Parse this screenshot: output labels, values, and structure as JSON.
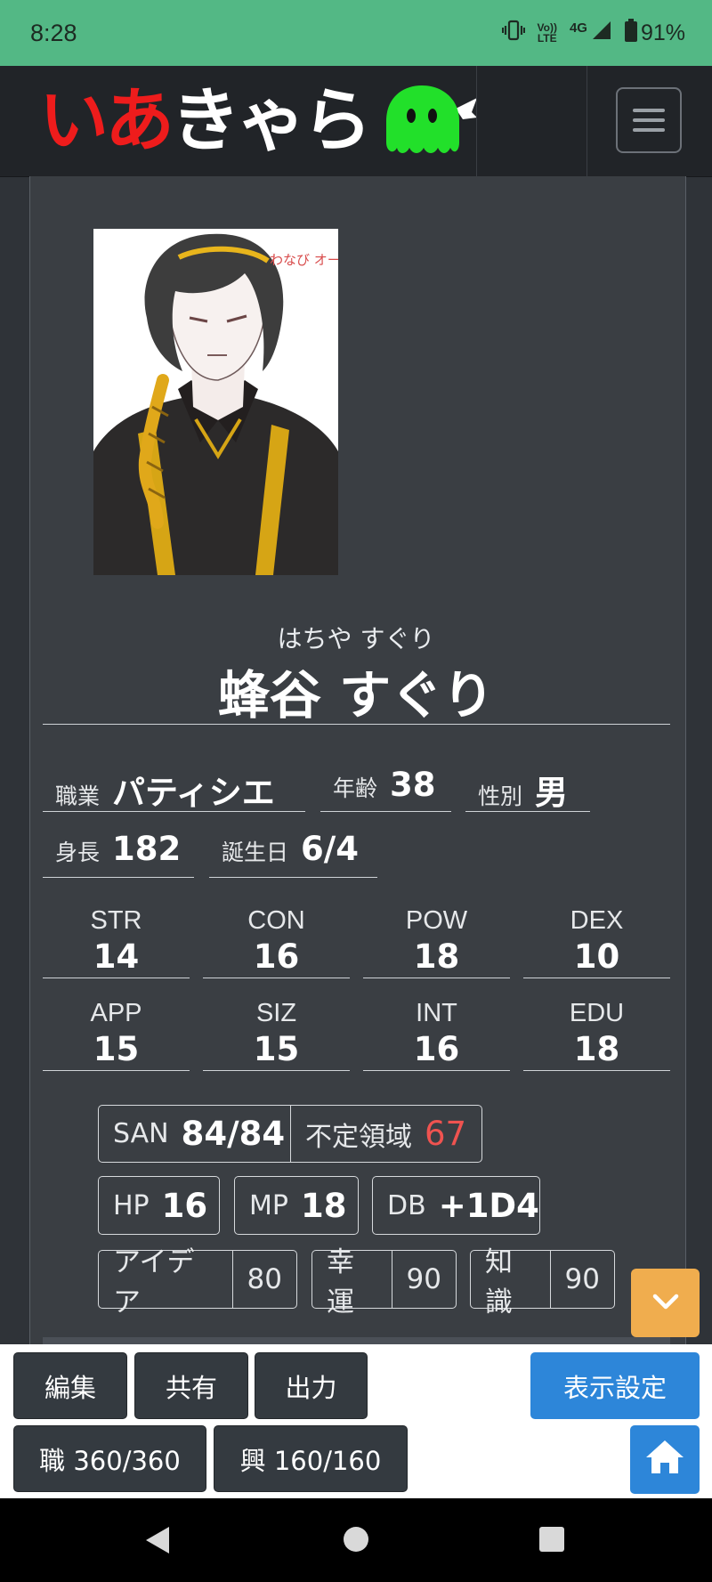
{
  "status_bar": {
    "time": "8:28",
    "network_label_top": "Vo))",
    "network_label_bottom": "LTE",
    "network_type": "4G",
    "battery": "91%"
  },
  "header": {
    "logo_red": "いあ",
    "logo_white": "きゃら",
    "menu_icon": "hamburger-icon"
  },
  "character": {
    "portrait_signature": "わなび オーナー(館)",
    "ruby": "はちや すぐり",
    "name": "蜂谷 すぐり",
    "profile": {
      "occupation_label": "職業",
      "occupation": "パティシエ",
      "age_label": "年齢",
      "age": "38",
      "gender_label": "性別",
      "gender": "男",
      "height_label": "身長",
      "height": "182",
      "birthday_label": "誕生日",
      "birthday": "6/4"
    },
    "stats": [
      {
        "label": "STR",
        "value": "14"
      },
      {
        "label": "CON",
        "value": "16"
      },
      {
        "label": "POW",
        "value": "18"
      },
      {
        "label": "DEX",
        "value": "10"
      },
      {
        "label": "APP",
        "value": "15"
      },
      {
        "label": "SIZ",
        "value": "15"
      },
      {
        "label": "INT",
        "value": "16"
      },
      {
        "label": "EDU",
        "value": "18"
      }
    ],
    "derived": {
      "san_label": "SAN",
      "san": "84/84",
      "indef_label": "不定領域",
      "indef": "67",
      "hp_label": "HP",
      "hp": "16",
      "mp_label": "MP",
      "mp": "18",
      "db_label": "DB",
      "db": "+1D4",
      "idea_label": "アイデア",
      "idea": "80",
      "luck_label": "幸運",
      "luck": "90",
      "know_label": "知識",
      "know": "90"
    }
  },
  "toolbar": {
    "edit": "編集",
    "share": "共有",
    "output": "出力",
    "display_settings": "表示設定",
    "job_points": "職 360/360",
    "interest_points": "興 160/160"
  },
  "colors": {
    "status_bar": "#53b885",
    "header": "#212428",
    "panel": "#3a3e43",
    "accent_orange": "#f0ad4e",
    "accent_blue": "#2d86d9",
    "logo_red": "#ee1c1c",
    "logo_mascot": "#22e02a",
    "indef_red": "#ef5350"
  }
}
